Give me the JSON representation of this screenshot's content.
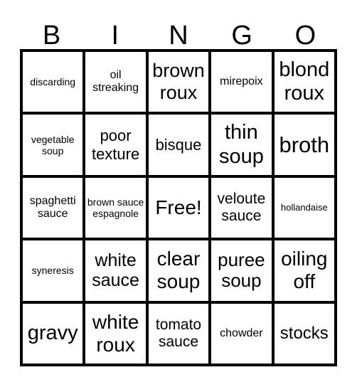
{
  "header": {
    "letters": [
      "B",
      "I",
      "N",
      "G",
      "O"
    ]
  },
  "cells": [
    [
      {
        "text": "discarding",
        "size": 14
      },
      {
        "text": "oil streaking",
        "size": 16
      },
      {
        "text": "brown roux",
        "size": 27
      },
      {
        "text": "mirepoix",
        "size": 16
      },
      {
        "text": "blond roux",
        "size": 29
      }
    ],
    [
      {
        "text": "vegetable soup",
        "size": 14
      },
      {
        "text": "poor texture",
        "size": 22
      },
      {
        "text": "bisque",
        "size": 22
      },
      {
        "text": "thin soup",
        "size": 29
      },
      {
        "text": "broth",
        "size": 31
      }
    ],
    [
      {
        "text": "spaghetti sauce",
        "size": 16
      },
      {
        "text": "brown sauce espagnole",
        "size": 14
      },
      {
        "text": "Free!",
        "size": 28
      },
      {
        "text": "veloute sauce",
        "size": 21
      },
      {
        "text": "hollandaise",
        "size": 13
      }
    ],
    [
      {
        "text": "syneresis",
        "size": 14
      },
      {
        "text": "white sauce",
        "size": 25
      },
      {
        "text": "clear soup",
        "size": 28
      },
      {
        "text": "puree soup",
        "size": 26
      },
      {
        "text": "oiling off",
        "size": 28
      }
    ],
    [
      {
        "text": "gravy",
        "size": 29
      },
      {
        "text": "white roux",
        "size": 28
      },
      {
        "text": "tomato sauce",
        "size": 21
      },
      {
        "text": "chowder",
        "size": 16
      },
      {
        "text": "stocks",
        "size": 24
      }
    ]
  ]
}
